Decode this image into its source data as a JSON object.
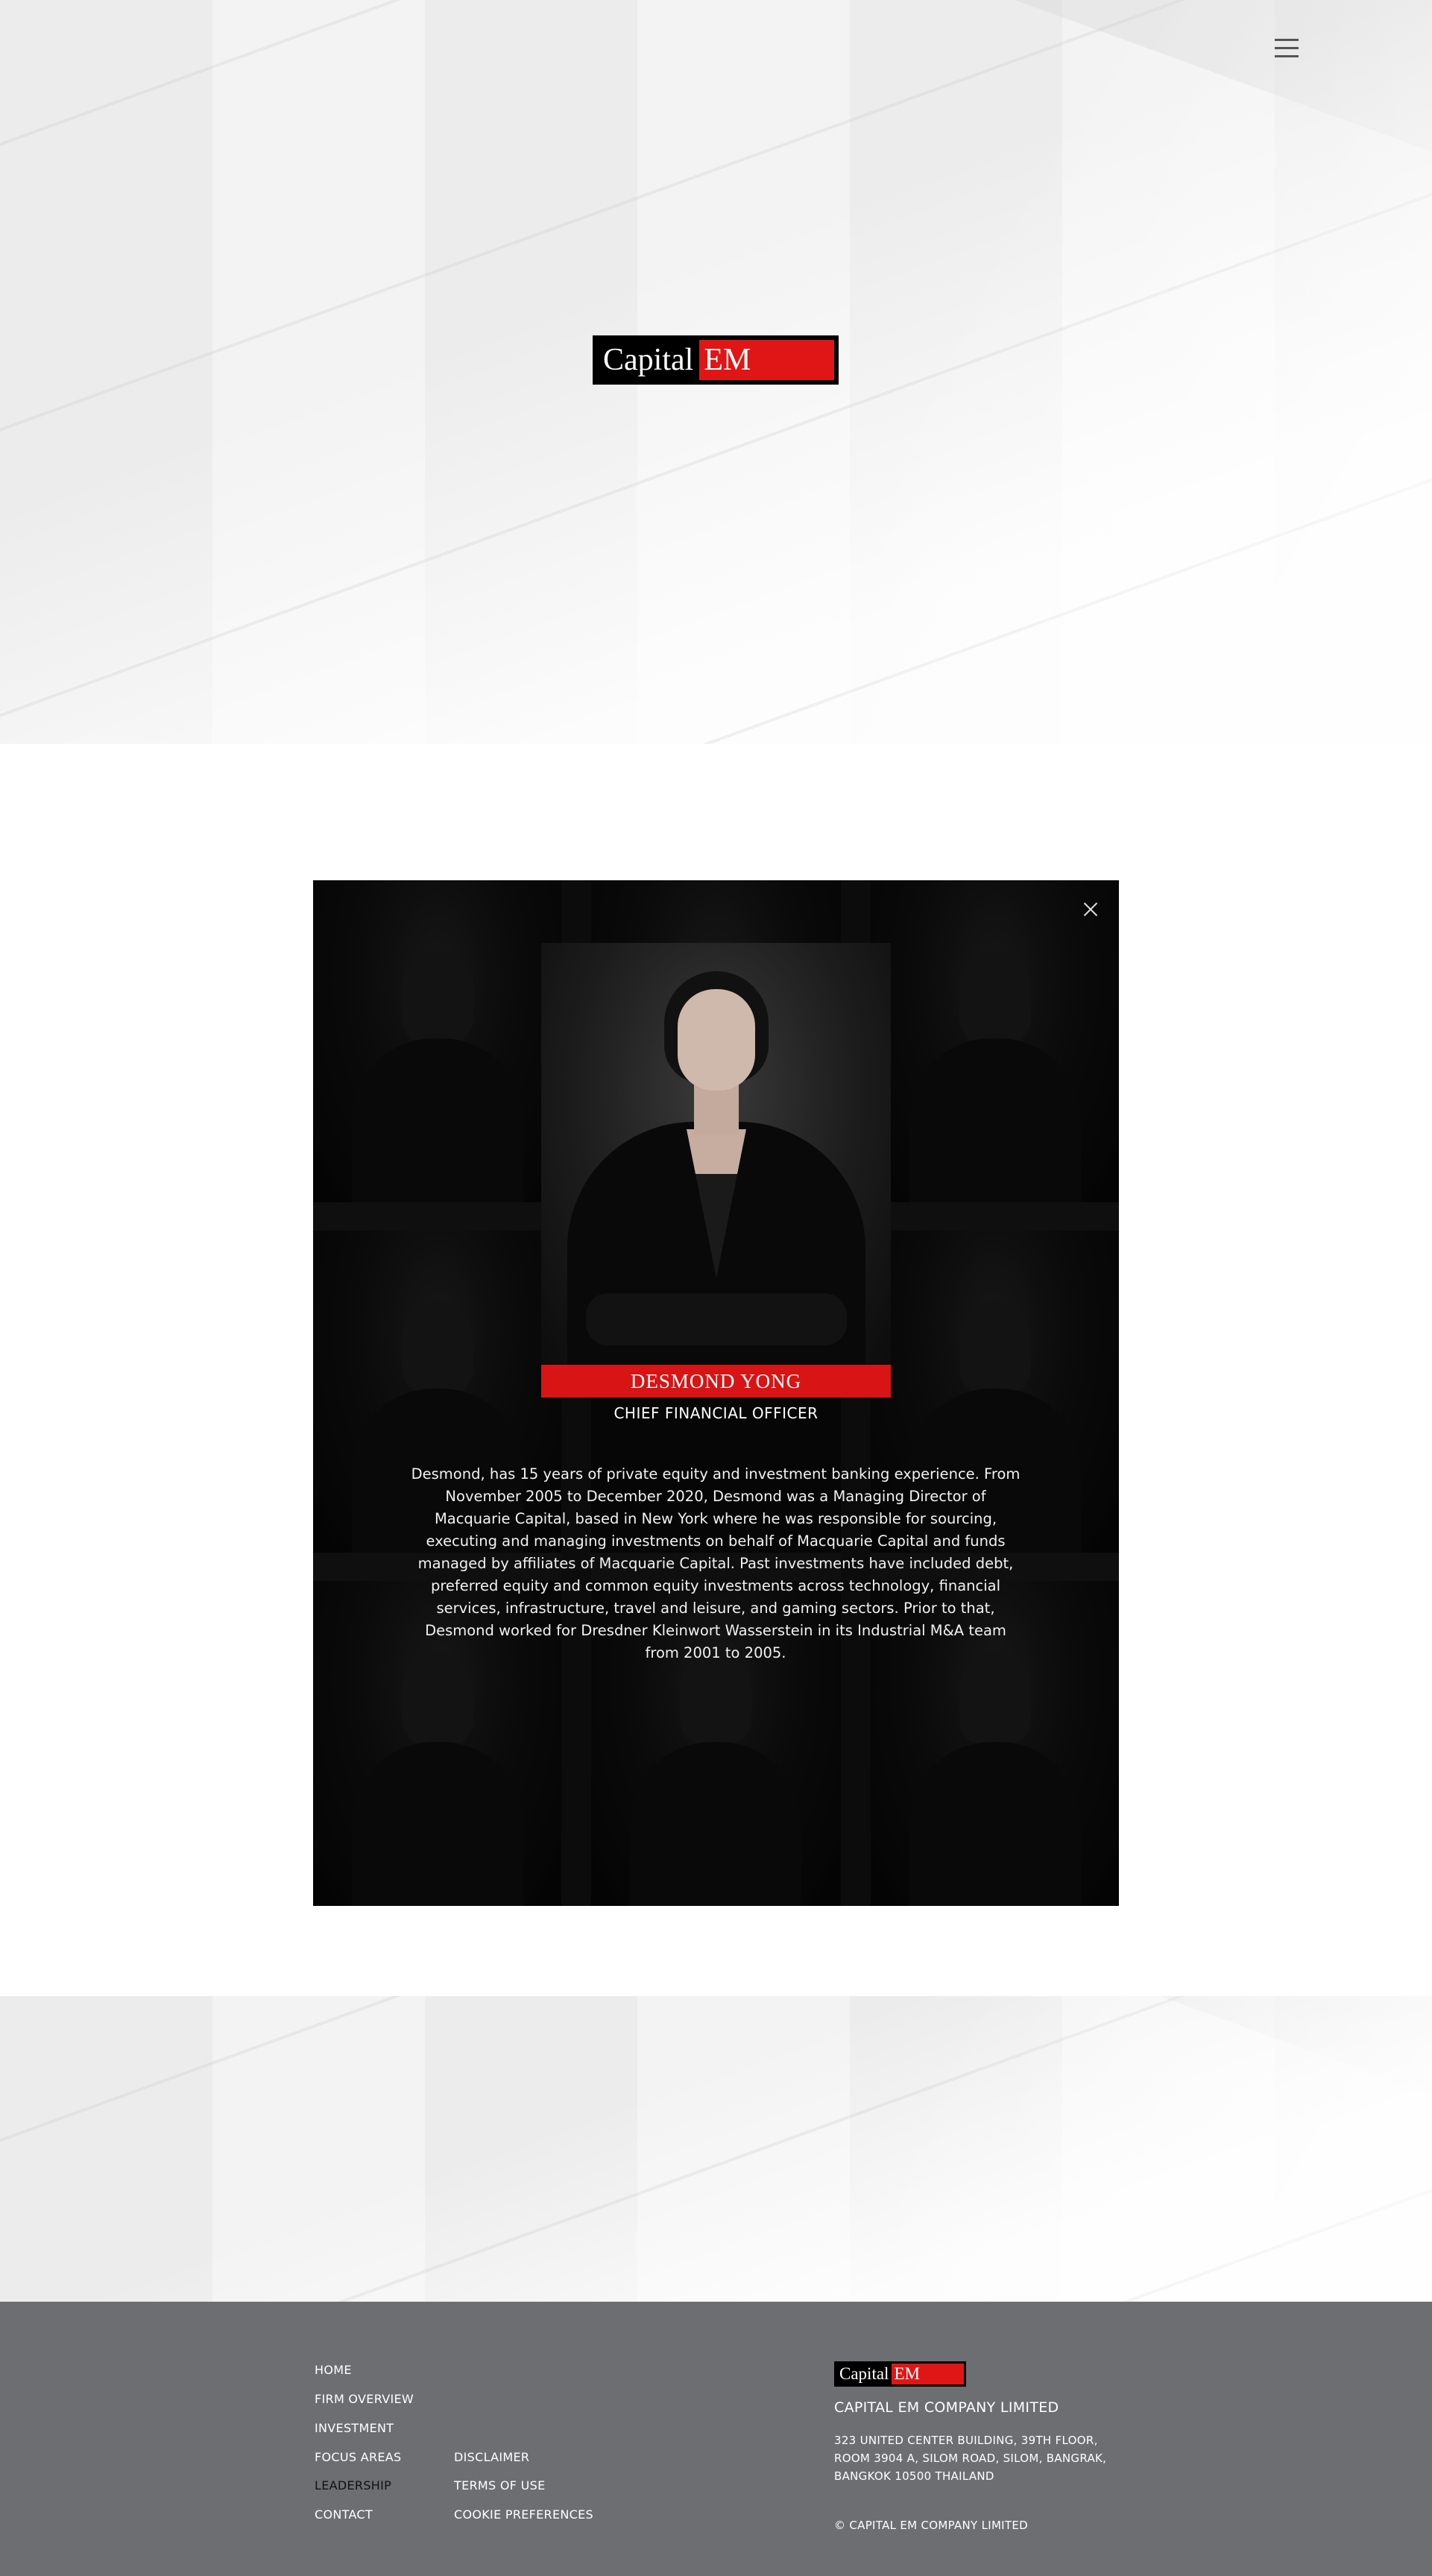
{
  "header": {
    "menu_icon": "hamburger-menu-icon",
    "logo": {
      "part1": "Capital",
      "part2": "EM"
    }
  },
  "modal": {
    "close_icon": "close-icon",
    "name": "DESMOND YONG",
    "role": "CHIEF FINANCIAL OFFICER",
    "bio": "Desmond, has 15 years of private equity and investment banking experience. From November 2005 to December 2020, Desmond was a Managing Director of Macquarie Capital, based in New York where he was responsible for sourcing, executing and managing investments on behalf of Macquarie Capital and funds managed by affiliates of Macquarie Capital. Past investments have included debt, preferred equity and common equity investments across technology, financial services, infrastructure, travel and leisure, and gaming sectors. Prior to that, Desmond worked for Dresdner Kleinwort Wasserstein in its Industrial M&A team from 2001 to 2005."
  },
  "footer": {
    "nav_col1": [
      "HOME",
      "FIRM OVERVIEW",
      "INVESTMENT",
      "FOCUS AREAS",
      "LEADERSHIP",
      "CONTACT"
    ],
    "nav_col2": [
      "DISCLAIMER",
      "TERMS OF USE",
      "COOKIE PREFERENCES"
    ],
    "active_item": "LEADERSHIP",
    "logo": {
      "part1": "Capital",
      "part2": "EM"
    },
    "company": "CAPITAL EM COMPANY LIMITED",
    "address_lines": [
      "323 UNITED CENTER BUILDING, 39TH FLOOR,",
      "ROOM 3904 A, SILOM ROAD, SILOM, BANGRAK,",
      "BANGKOK 10500 THAILAND"
    ],
    "copyright": "© CAPITAL EM COMPANY LIMITED"
  },
  "colors": {
    "brand_red": "#e01616",
    "footer_bg": "#6d6e71",
    "modal_bg": "#0b0b0b"
  }
}
